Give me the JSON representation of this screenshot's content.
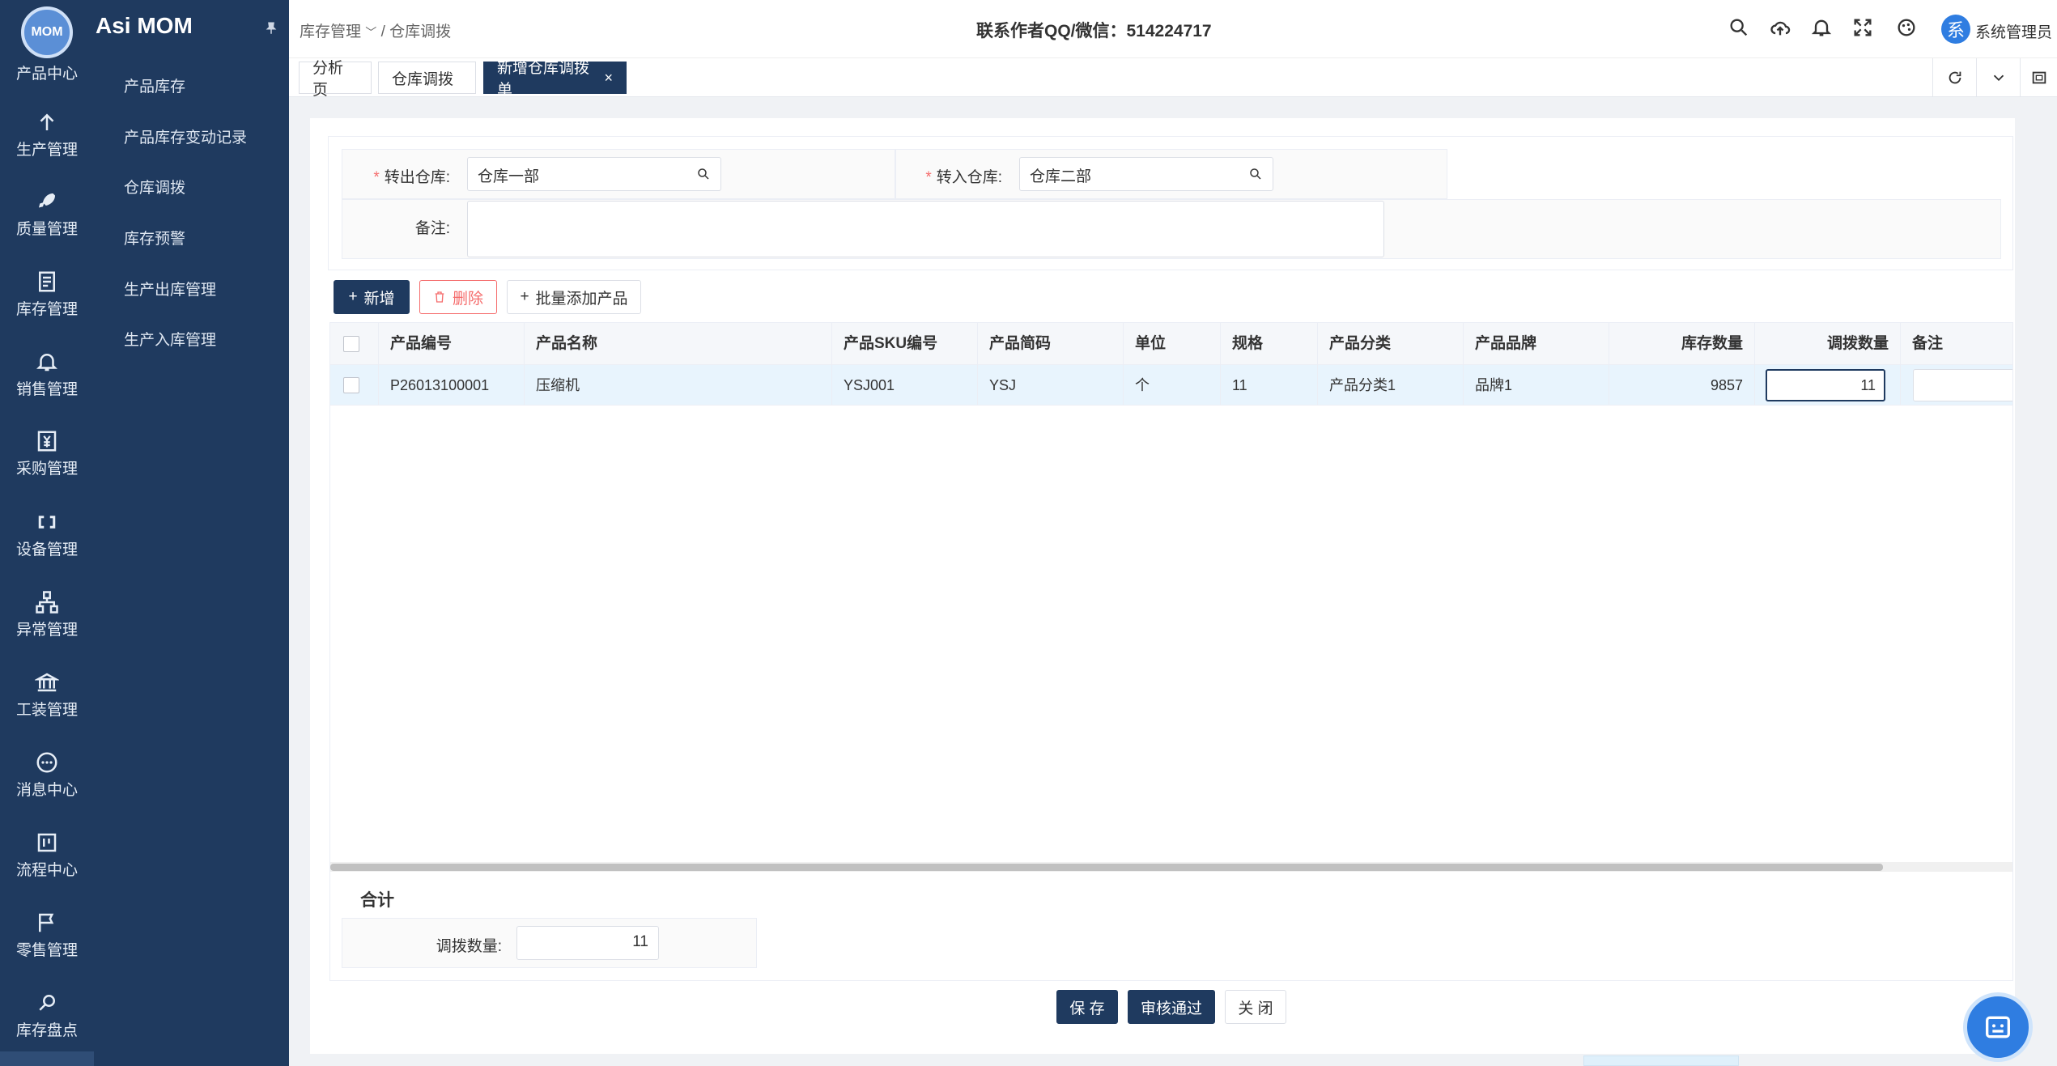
{
  "app": {
    "brand": "Asi MOM",
    "logo_text": "MOM"
  },
  "rail": [
    {
      "label": "产品中心",
      "icon": "box-icon"
    },
    {
      "label": "生产管理",
      "icon": "arrow-up-icon"
    },
    {
      "label": "质量管理",
      "icon": "rocket-icon"
    },
    {
      "label": "库存管理",
      "icon": "document-icon"
    },
    {
      "label": "销售管理",
      "icon": "bell-icon"
    },
    {
      "label": "采购管理",
      "icon": "yen-icon"
    },
    {
      "label": "设备管理",
      "icon": "link-icon"
    },
    {
      "label": "异常管理",
      "icon": "hierarchy-icon"
    },
    {
      "label": "工装管理",
      "icon": "bank-icon"
    },
    {
      "label": "消息中心",
      "icon": "chat-icon"
    },
    {
      "label": "流程中心",
      "icon": "flow-icon"
    },
    {
      "label": "零售管理",
      "icon": "flag-icon"
    },
    {
      "label": "库存盘点",
      "icon": "search-doc-icon"
    }
  ],
  "submenu": [
    "产品库存",
    "产品库存变动记录",
    "仓库调拨",
    "库存预警",
    "生产出库管理",
    "生产入库管理"
  ],
  "header": {
    "breadcrumb_parent": "库存管理",
    "breadcrumb_sep": "/",
    "breadcrumb_current": "仓库调拨",
    "contact": "联系作者QQ/微信：514224717",
    "avatar_char": "系",
    "username": "系统管理员"
  },
  "tabs": [
    "分析页",
    "仓库调拨",
    "新增仓库调拨单"
  ],
  "form": {
    "from_label": "转出仓库:",
    "from_value": "仓库一部",
    "to_label": "转入仓库:",
    "to_value": "仓库二部",
    "remark_label": "备注:",
    "required_mark": "*"
  },
  "toolbar": {
    "add": "新增",
    "delete": "删除",
    "batch_add": "批量添加产品"
  },
  "table": {
    "columns": [
      "产品编号",
      "产品名称",
      "产品SKU编号",
      "产品简码",
      "单位",
      "规格",
      "产品分类",
      "产品品牌",
      "库存数量",
      "调拨数量",
      "备注"
    ],
    "rows": [
      {
        "code": "P26013100001",
        "name": "压缩机",
        "sku": "YSJ001",
        "short": "YSJ",
        "unit": "个",
        "spec": "11",
        "category": "产品分类1",
        "brand": "品牌1",
        "stock": "9857",
        "qty": "11",
        "remark": ""
      }
    ]
  },
  "summary": {
    "title": "合计",
    "label": "调拨数量:",
    "value": "11"
  },
  "actions": {
    "save": "保 存",
    "approve": "审核通过",
    "close": "关 闭"
  },
  "colors": {
    "primary": "#1f3a5f",
    "danger": "#f56c6c",
    "accent": "#2f7de1"
  }
}
